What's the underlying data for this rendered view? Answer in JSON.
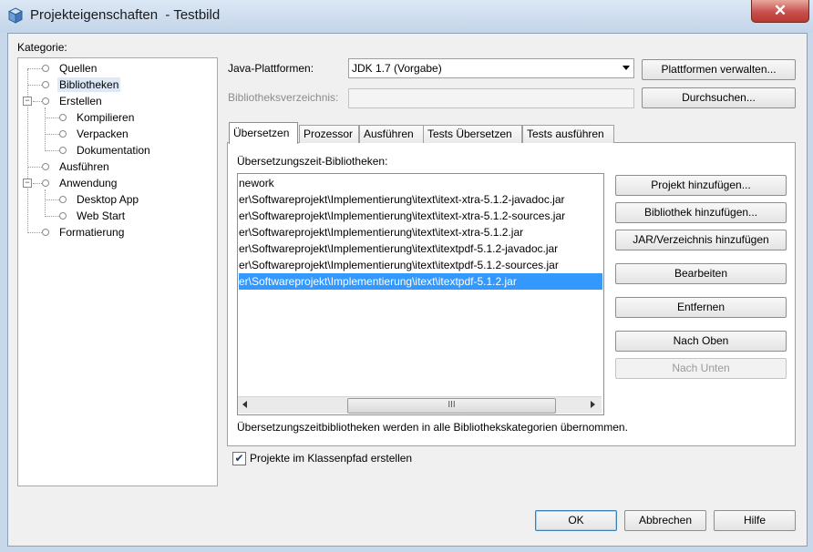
{
  "window": {
    "title": "Projekteigenschaften  - Testbild",
    "close_symbol": "✕"
  },
  "category_label": "Kategorie:",
  "tree": [
    {
      "label": "Quellen",
      "level": 0,
      "selected": false
    },
    {
      "label": "Bibliotheken",
      "level": 0,
      "selected": true
    },
    {
      "label": "Erstellen",
      "level": 0,
      "selected": false,
      "expander": "−"
    },
    {
      "label": "Kompilieren",
      "level": 1,
      "selected": false
    },
    {
      "label": "Verpacken",
      "level": 1,
      "selected": false
    },
    {
      "label": "Dokumentation",
      "level": 1,
      "selected": false
    },
    {
      "label": "Ausführen",
      "level": 0,
      "selected": false
    },
    {
      "label": "Anwendung",
      "level": 0,
      "selected": false,
      "expander": "−"
    },
    {
      "label": "Desktop App",
      "level": 1,
      "selected": false
    },
    {
      "label": "Web Start",
      "level": 1,
      "selected": false
    },
    {
      "label": "Formatierung",
      "level": 0,
      "selected": false
    }
  ],
  "platform": {
    "label": "Java-Plattformen:",
    "value": "JDK 1.7 (Vorgabe)",
    "manage_button": "Plattformen verwalten..."
  },
  "libdir": {
    "label": "Bibliotheksverzeichnis:",
    "value": "",
    "browse_button": "Durchsuchen..."
  },
  "tabs": [
    "Übersetzen",
    "Prozessor",
    "Ausführen",
    "Tests Übersetzen",
    "Tests ausführen"
  ],
  "compile": {
    "list_label": "Übersetzungszeit-Bibliotheken:",
    "items": [
      "nework",
      "er\\Softwareprojekt\\Implementierung\\itext\\itext-xtra-5.1.2-javadoc.jar",
      "er\\Softwareprojekt\\Implementierung\\itext\\itext-xtra-5.1.2-sources.jar",
      "er\\Softwareprojekt\\Implementierung\\itext\\itext-xtra-5.1.2.jar",
      "er\\Softwareprojekt\\Implementierung\\itext\\itextpdf-5.1.2-javadoc.jar",
      "er\\Softwareprojekt\\Implementierung\\itext\\itextpdf-5.1.2-sources.jar",
      "er\\Softwareprojekt\\Implementierung\\itext\\itextpdf-5.1.2.jar"
    ],
    "selected_index": 6,
    "scroll_grip": "III",
    "buttons": {
      "add_project": "Projekt hinzufügen...",
      "add_library": "Bibliothek hinzufügen...",
      "add_jar": "JAR/Verzeichnis hinzufügen",
      "edit": "Bearbeiten",
      "remove": "Entfernen",
      "move_up": "Nach Oben",
      "move_down": "Nach Unten"
    },
    "note": "Übersetzungszeitbibliotheken werden in alle Bibliothekskategorien übernommen."
  },
  "build_projects": {
    "label": "Projekte im Klassenpfad erstellen",
    "checked": true,
    "check_symbol": "✔"
  },
  "footer": {
    "ok": "OK",
    "cancel": "Abbrechen",
    "help": "Hilfe"
  }
}
